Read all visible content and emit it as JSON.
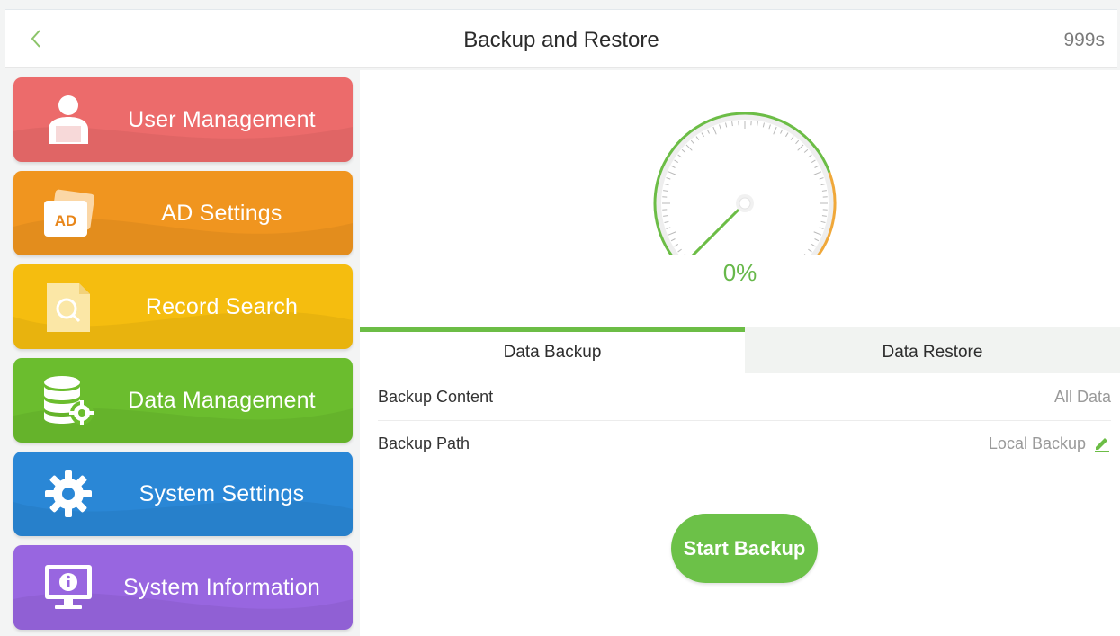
{
  "header": {
    "title": "Backup and Restore",
    "timer": "999s"
  },
  "sidebar": {
    "items": [
      {
        "label": "User Management",
        "color": "#ec6b6b",
        "icon": "user-icon"
      },
      {
        "label": "AD Settings",
        "color": "#f0951f",
        "icon": "ad-icon",
        "icon_text": "AD"
      },
      {
        "label": "Record Search",
        "color": "#f5bd0f",
        "icon": "record-search-icon"
      },
      {
        "label": "Data Management",
        "color": "#6bbd2e",
        "icon": "database-gear-icon"
      },
      {
        "label": "System Settings",
        "color": "#2a87d6",
        "icon": "gear-icon"
      },
      {
        "label": "System Information",
        "color": "#9866e0",
        "icon": "monitor-info-icon"
      }
    ]
  },
  "progress": {
    "percent_text": "0%",
    "value": 0
  },
  "tabs": [
    {
      "label": "Data Backup",
      "active": true
    },
    {
      "label": "Data Restore",
      "active": false
    }
  ],
  "settings": {
    "backup_content": {
      "label": "Backup Content",
      "value": "All Data"
    },
    "backup_path": {
      "label": "Backup Path",
      "value": "Local Backup"
    }
  },
  "actions": {
    "start_label": "Start Backup"
  },
  "colors": {
    "accent_green": "#6cbd46",
    "gauge_orange": "#f0a83a"
  }
}
